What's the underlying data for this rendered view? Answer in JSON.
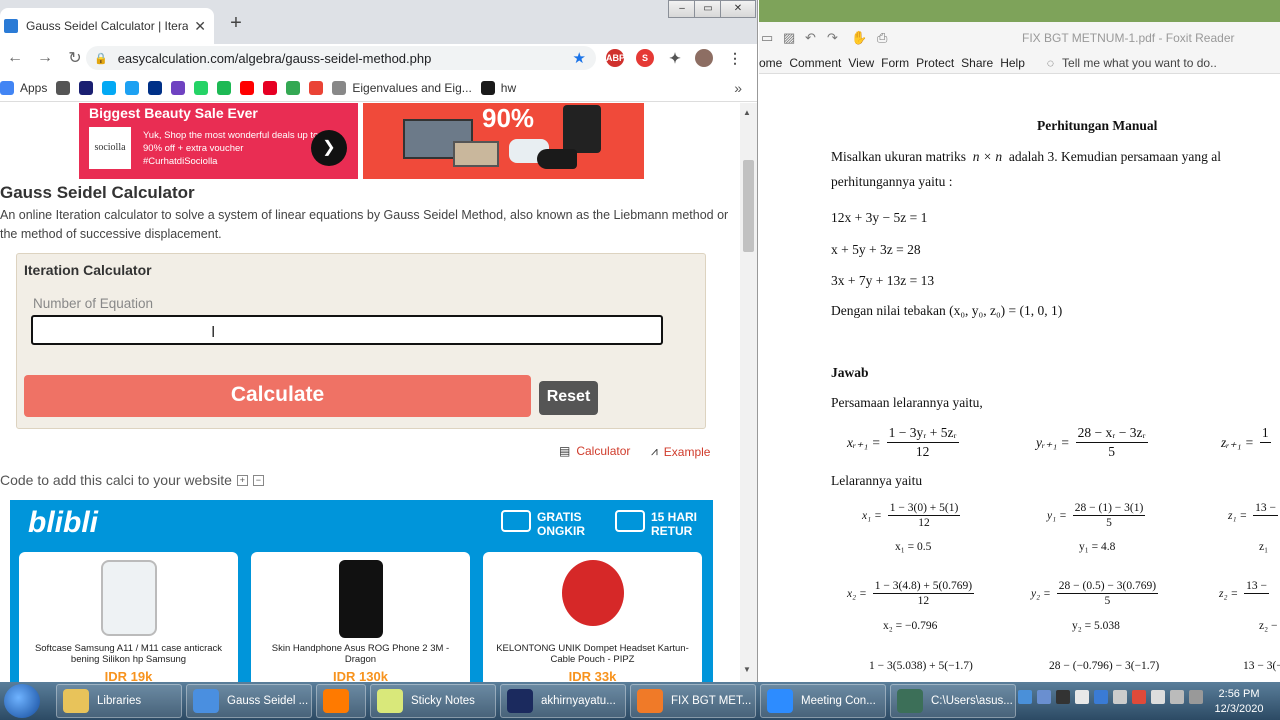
{
  "chrome": {
    "tab_title": "Gauss Seidel Calculator | Iteration",
    "new_tab": "+",
    "close_tab": "✕",
    "url": "easycalculation.com/algebra/gauss-seidel-method.php",
    "bookmarks": [
      {
        "label": "Apps",
        "color": "#4285f4"
      },
      {
        "label": "",
        "color": "#555555"
      },
      {
        "label": "",
        "color": "#1a1f71"
      },
      {
        "label": "",
        "color": "#03a9f4"
      },
      {
        "label": "",
        "color": "#1da1f2"
      },
      {
        "label": "",
        "color": "#003087"
      },
      {
        "label": "",
        "color": "#6f42c1"
      },
      {
        "label": "",
        "color": "#25d366"
      },
      {
        "label": "",
        "color": "#1db954"
      },
      {
        "label": "",
        "color": "#ff0000"
      },
      {
        "label": "",
        "color": "#e60023"
      },
      {
        "label": "",
        "color": "#34a853"
      },
      {
        "label": "",
        "color": "#ea4335"
      },
      {
        "label": "Eigenvalues and Eig...",
        "color": "#888888"
      },
      {
        "label": "hw",
        "color": "#1a1a1a"
      }
    ],
    "bookmarks_more": "»"
  },
  "page": {
    "ad1_heading": "Biggest Beauty Sale Ever",
    "ad1_logo": "sociolla",
    "ad1_text": "Yuk, Shop the most wonderful deals up to 90% off + extra voucher #CurhatdiSociolla",
    "ad2_percent": "90%",
    "title": "Gauss Seidel Calculator",
    "description": "An online Iteration calculator to solve a system of linear equations by Gauss Seidel Method, also known as the Liebmann method or the method of successive displacement.",
    "calc_title": "Iteration Calculator",
    "field_label": "Number of Equation",
    "field_value": "",
    "calculate": "Calculate",
    "reset": "Reset",
    "link_calculator": "Calculator",
    "link_example": "Example",
    "embed_text": "Code to add this calci to your website",
    "blibli_logo": "blibli",
    "badge1": "GRATIS ONGKIR",
    "badge2": "15 HARI RETUR",
    "products": [
      {
        "caption": "Softcase Samsung A11 / M11 case anticrack bening Silikon hp Samsung",
        "price": "IDR 19k"
      },
      {
        "caption": "Skin Handphone Asus ROG Phone 2 3M - Dragon",
        "price": "IDR 130k"
      },
      {
        "caption": "KELONTONG UNIK Dompet Headset Kartun- Cable Pouch - PIPZ",
        "price": "IDR 33k"
      }
    ]
  },
  "foxit": {
    "title": "FIX BGT METNUM-1.pdf - Foxit Reader",
    "menu": [
      "ome",
      "Comment",
      "View",
      "Form",
      "Protect",
      "Share",
      "Help"
    ],
    "tell_me": "Tell me what you want to do..",
    "doc": {
      "heading": "Perhitungan Manual",
      "p1a": "Misalkan ukuran matriks",
      "p1b": "n × n",
      "p1c": "adalah 3. Kemudian persamaan yang al",
      "p2": "perhitungannya yaitu :",
      "eq1": "12x + 3y − 5z = 1",
      "eq2": "x + 5y + 3z = 28",
      "eq3": "3x + 7y + 13z = 13",
      "guess": "Dengan nilai tebakan (x₀, y₀, z₀) = (1, 0, 1)",
      "jawab": "Jawab",
      "iter_intro": "Persamaan lelarannya yaitu,",
      "xr_lhs": "xᵣ₊₁ =",
      "xr_num": "1 − 3yᵣ + 5zᵣ",
      "xr_den": "12",
      "yr_lhs": "yᵣ₊₁ =",
      "yr_num": "28 − xᵣ − 3zᵣ",
      "yr_den": "5",
      "zr_lhs": "zᵣ₊₁ =",
      "zr_num": "1",
      "lelaran": "Lelarannya yaitu",
      "x1_lhs": "x₁ =",
      "x1_num": "1 − 3(0) + 5(1)",
      "x1_den": "12",
      "x1_val": "x₁ = 0.5",
      "y1_lhs": "y₁ =",
      "y1_num": "28 − (1) − 3(1)",
      "y1_den": "5",
      "y1_val": "y₁ = 4.8",
      "z1_lhs": "z₁ =",
      "z1_num": "13 −",
      "z1_val": "z₁",
      "x2_lhs": "x₂ =",
      "x2_num": "1 − 3(4.8) + 5(0.769)",
      "x2_den": "12",
      "x2_val": "x₂ = −0.796",
      "y2_lhs": "y₂ =",
      "y2_num": "28 − (0.5) − 3(0.769)",
      "y2_den": "5",
      "y2_val": "y₂ = 5.038",
      "z2_lhs": "z₂ =",
      "z2_num": "13 −",
      "z2_val": "z₂ −",
      "x3_num": "1 − 3(5.038) + 5(−1.7)",
      "y3_num": "28 − (−0.796) − 3(−1.7)",
      "z3_num": "13 − 3(−"
    }
  },
  "taskbar": {
    "items": [
      {
        "label": "Libraries",
        "color": "#e8c35a"
      },
      {
        "label": "Gauss Seidel ...",
        "color": "#4a8fe0"
      },
      {
        "label": "",
        "color": "#ff7a00"
      },
      {
        "label": "Sticky Notes",
        "color": "#d9e87a"
      },
      {
        "label": "akhirnyayatu...",
        "color": "#1b2a5e"
      },
      {
        "label": "FIX BGT MET...",
        "color": "#f07a28"
      },
      {
        "label": "Meeting Con...",
        "color": "#2d8cff"
      },
      {
        "label": "C:\\Users\\asus...",
        "color": "#3c6f58"
      }
    ],
    "time": "2:56 PM",
    "date": "12/3/2020"
  }
}
